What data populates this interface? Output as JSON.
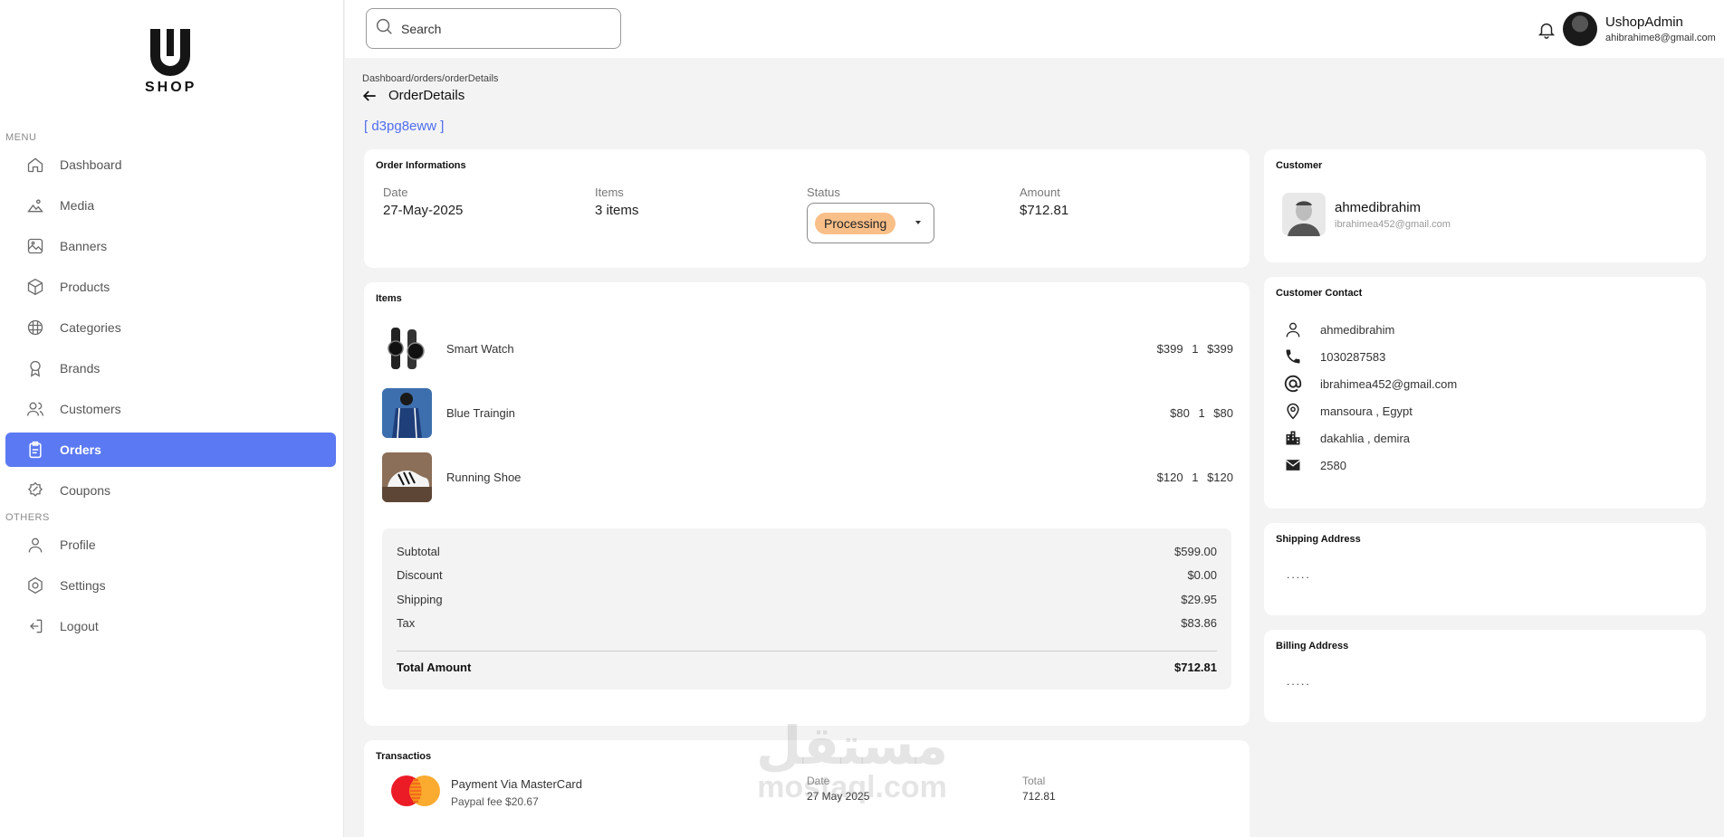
{
  "brand": {
    "logo_text": "SHOP"
  },
  "sidebar": {
    "menu_label": "MENU",
    "others_label": "OTHERS",
    "items": [
      {
        "label": "Dashboard",
        "icon": "home-icon"
      },
      {
        "label": "Media",
        "icon": "image-icon"
      },
      {
        "label": "Banners",
        "icon": "banner-icon"
      },
      {
        "label": "Products",
        "icon": "box-icon"
      },
      {
        "label": "Categories",
        "icon": "grid-icon"
      },
      {
        "label": "Brands",
        "icon": "award-icon"
      },
      {
        "label": "Customers",
        "icon": "users-icon"
      },
      {
        "label": "Orders",
        "icon": "clipboard-icon",
        "active": true
      },
      {
        "label": "Coupons",
        "icon": "coupon-icon"
      }
    ],
    "others": [
      {
        "label": "Profile",
        "icon": "user-icon"
      },
      {
        "label": "Settings",
        "icon": "gear-icon"
      },
      {
        "label": "Logout",
        "icon": "logout-icon"
      }
    ]
  },
  "header": {
    "search_placeholder": "Search",
    "admin_name": "UshopAdmin",
    "admin_email": "ahibrahime8@gmail.com"
  },
  "page": {
    "breadcrumb": "Dashboard/orders/orderDetails",
    "title": "OrderDetails",
    "order_id": "[ d3pg8eww ]"
  },
  "order_info": {
    "title": "Order Informations",
    "date_label": "Date",
    "date": "27-May-2025",
    "items_label": "Items",
    "items": "3 items",
    "status_label": "Status",
    "status": "Processing",
    "status_color": "#f9bf88",
    "amount_label": "Amount",
    "amount": "$712.81"
  },
  "items_card": {
    "title": "Items",
    "rows": [
      {
        "name": "Smart Watch",
        "price": "$399",
        "qty": "1",
        "total": "$399"
      },
      {
        "name": "Blue Traingin",
        "price": "$80",
        "qty": "1",
        "total": "$80"
      },
      {
        "name": "Running Shoe",
        "price": "$120",
        "qty": "1",
        "total": "$120"
      }
    ],
    "summary": {
      "subtotal_label": "Subtotal",
      "subtotal": "$599.00",
      "discount_label": "Discount",
      "discount": "$0.00",
      "shipping_label": "Shipping",
      "shipping": "$29.95",
      "tax_label": "Tax",
      "tax": "$83.86",
      "total_label": "Total Amount",
      "total": "$712.81"
    }
  },
  "transactions": {
    "title": "Transactios",
    "method": "Payment Via MasterCard",
    "fee": "Paypal fee  $20.67",
    "date_label": "Date",
    "date": "27 May 2025",
    "total_label": "Total",
    "total": "712.81"
  },
  "customer": {
    "title": "Customer",
    "name": "ahmedibrahim",
    "email": "ibrahimea452@gmail.com"
  },
  "contact": {
    "title": "Customer Contact",
    "name": "ahmedibrahim",
    "phone": "1030287583",
    "email": "ibrahimea452@gmail.com",
    "location": "mansoura , Egypt",
    "city": "dakahlia , demira",
    "postal": "2580"
  },
  "shipping_address": {
    "title": "Shipping Address",
    "value": "....."
  },
  "billing_address": {
    "title": "Billing Address",
    "value": "....."
  },
  "watermark": {
    "line1": "مستقل",
    "line2": "mostaql.com"
  },
  "accent": "#5b79f2"
}
